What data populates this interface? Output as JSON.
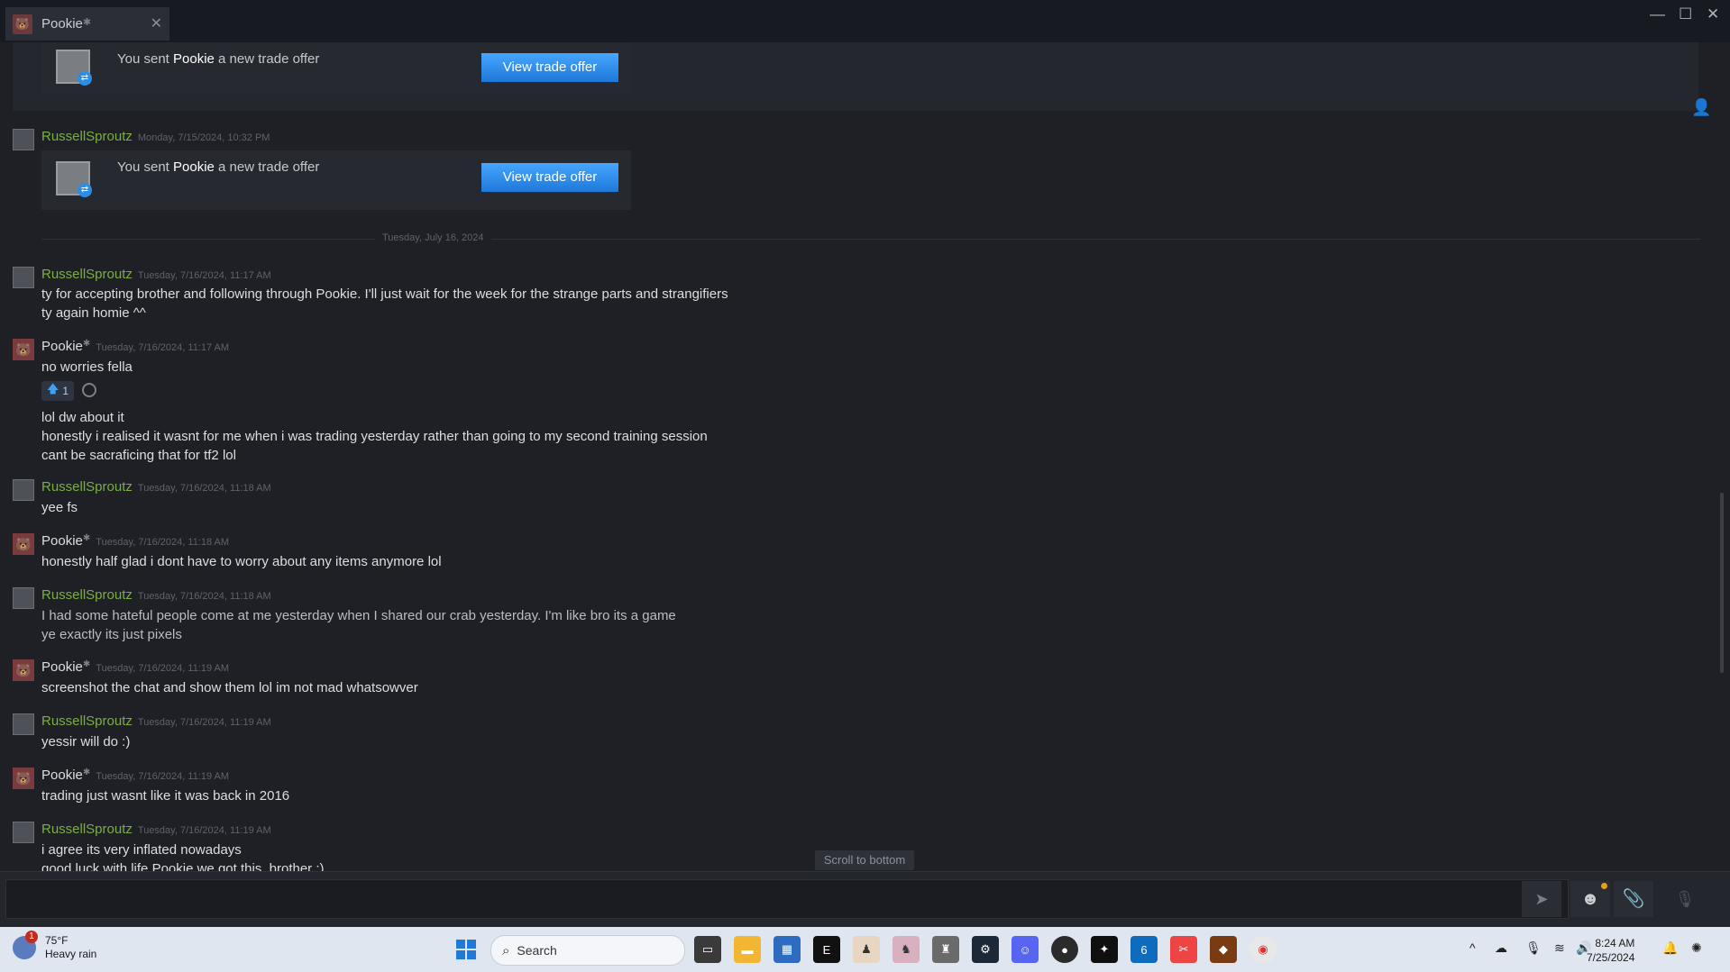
{
  "window": {
    "tab_title": "Pookie",
    "tab_star": "✱",
    "close_glyph": "✕",
    "minimize_glyph": "—",
    "maximize_glyph": "☐",
    "window_close_glyph": "✕"
  },
  "trade_offers": [
    {
      "prefix": "You sent ",
      "name": "Pookie",
      "suffix": " a new trade offer",
      "button": "View trade offer"
    },
    {
      "prefix": "You sent ",
      "name": "Pookie",
      "suffix": " a new trade offer",
      "button": "View trade offer"
    }
  ],
  "first_header": {
    "name": "RussellSproutz",
    "time": "Monday, 7/15/2024, 10:32 PM"
  },
  "date_separator": "Tuesday, July 16, 2024",
  "messages": [
    {
      "name": "RussellSproutz",
      "time": "Tuesday, 7/16/2024, 11:17 AM",
      "lines": [
        "ty for accepting brother and following through Pookie. I'll just wait for the week for the strange parts and strangifiers",
        "ty again homie ^^"
      ]
    },
    {
      "name": "Pookie",
      "time": "Tuesday, 7/16/2024, 11:17 AM",
      "lines": [
        "no worries fella",
        "lol dw about it",
        "honestly i realised it wasnt for me when i was trading yesterday rather than going to my second training session",
        "cant be sacraficing that for tf2 lol"
      ]
    },
    {
      "name": "RussellSproutz",
      "time": "Tuesday, 7/16/2024, 11:18 AM",
      "lines": [
        "yee fs"
      ]
    },
    {
      "name": "Pookie",
      "time": "Tuesday, 7/16/2024, 11:18 AM",
      "lines": [
        "honestly half glad i dont have to worry about any items anymore lol"
      ]
    },
    {
      "name": "RussellSproutz",
      "time": "Tuesday, 7/16/2024, 11:18 AM",
      "lines": [
        "I had some hateful people come at me yesterday when I shared our crab yesterday. I'm like bro its a game",
        "ye exactly its just pixels"
      ]
    },
    {
      "name": "Pookie",
      "time": "Tuesday, 7/16/2024, 11:19 AM",
      "lines": [
        "screenshot the chat and show them lol im not mad whatsowver"
      ]
    },
    {
      "name": "RussellSproutz",
      "time": "Tuesday, 7/16/2024, 11:19 AM",
      "lines": [
        "yessir will do :)"
      ]
    },
    {
      "name": "Pookie",
      "time": "Tuesday, 7/16/2024, 11:19 AM",
      "lines": [
        "trading just wasnt like it was back in 2016"
      ]
    },
    {
      "name": "RussellSproutz",
      "time": "Tuesday, 7/16/2024, 11:19 AM",
      "lines": [
        "i agree its very inflated nowadays",
        "good luck with life Pookie we got this, brother :)"
      ]
    }
  ],
  "reaction": {
    "count": "1",
    "icon": "thumbs-up-icon"
  },
  "scroll_to_bottom": "Scroll to bottom",
  "composer": {
    "placeholder": ""
  },
  "taskbar": {
    "weather_temp": "75°F",
    "weather_desc": "Heavy rain",
    "weather_badge": "1",
    "search_label": "Search",
    "outlook_badge": "6",
    "time": "8:24 AM",
    "date": "7/25/2024"
  },
  "colors": {
    "steam_green": "#7ab040",
    "button_blue": "#1e78d8",
    "background": "#1e2025"
  }
}
